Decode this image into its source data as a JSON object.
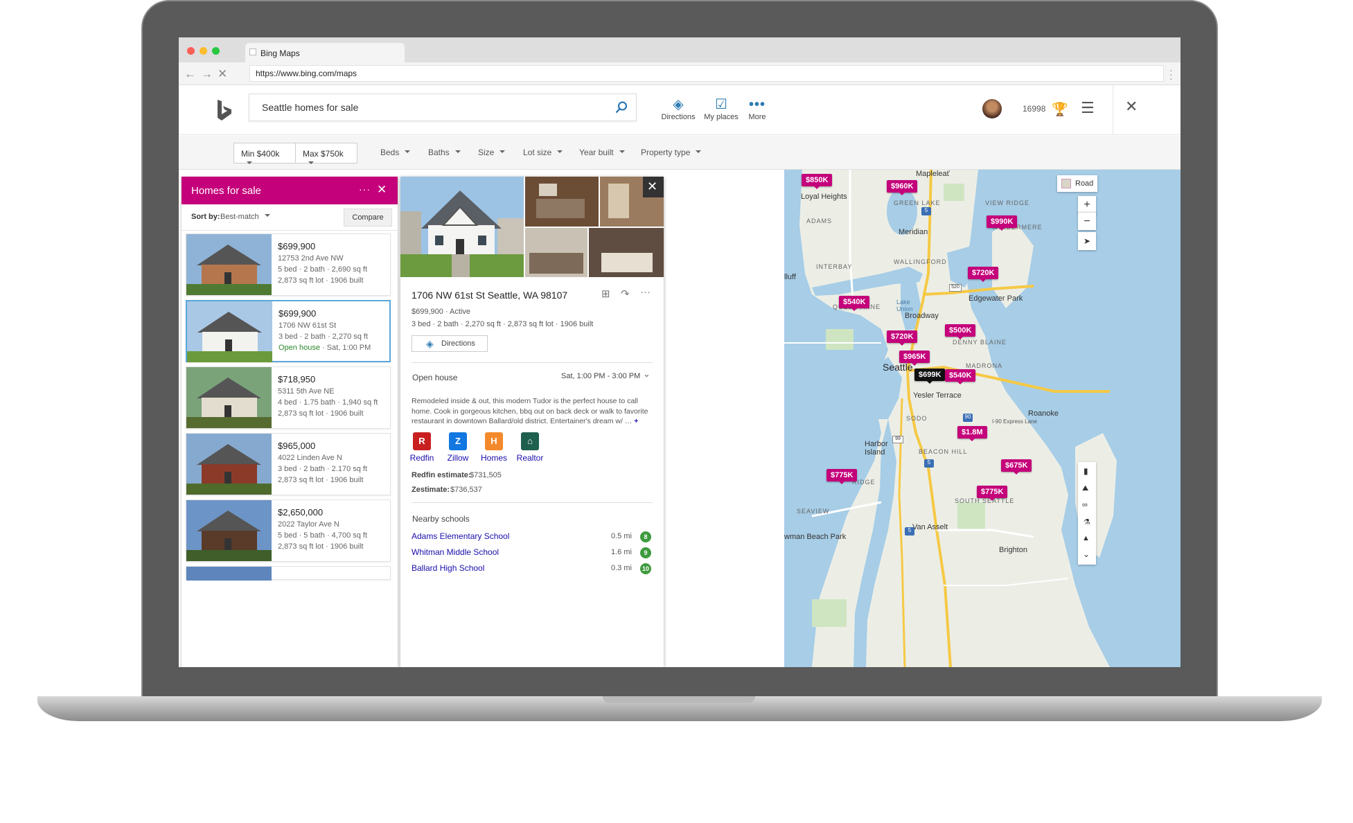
{
  "browser": {
    "tab_title": "Bing Maps",
    "url": "https://www.bing.com/maps"
  },
  "header": {
    "search_value": "Seattle homes for sale",
    "directions_label": "Directions",
    "my_places_label": "My places",
    "more_label": "More",
    "points": "16998"
  },
  "filters": {
    "min_price": "Min $400k",
    "max_price": "Max $750k",
    "beds": "Beds",
    "baths": "Baths",
    "size": "Size",
    "lot_size": "Lot size",
    "year_built": "Year built",
    "property_type": "Property type"
  },
  "results": {
    "title": "Homes for sale",
    "sort_label": "Sort by:",
    "sort_value": "Best-match",
    "compare_label": "Compare",
    "items": [
      {
        "price": "$699,900",
        "address": "12753 2nd Ave NW",
        "details": "5 bed · 2 bath · 2,690 sq ft",
        "extra": "2,873 sq ft lot · 1906 built"
      },
      {
        "price": "$699,900",
        "address": "1706 NW 61st St",
        "details": "3 bed · 2 bath · 2,270 sq ft",
        "open_house": "Open house",
        "extra": "· Sat, 1:00 PM"
      },
      {
        "price": "$718,950",
        "address": "5311 5th Ave NE",
        "details": "4 bed · 1.75 bath · 1,940 sq ft",
        "extra": "2,873 sq ft lot · 1906 built"
      },
      {
        "price": "$965,000",
        "address": "4022 Linden Ave N",
        "details": "3 bed · 2 bath · 2.170 sq ft",
        "extra": "2,873 sq ft lot · 1906 built"
      },
      {
        "price": "$2,650,000",
        "address": "2022 Taylor Ave N",
        "details": "5 bed · 5 bath · 4,700 sq ft",
        "extra": "2,873 sq ft lot · 1906 built"
      }
    ]
  },
  "detail": {
    "address": "1706 NW 61st St Seattle, WA 98107",
    "price_status": "$699,900 · Active",
    "specs": "3 bed · 2 bath · 2,270 sq ft · 2,873 sq ft lot · 1906 built",
    "directions_label": "Directions",
    "open_house_label": "Open house",
    "open_house_time": "Sat, 1:00 PM - 3:00 PM",
    "description": "Remodeled inside & out, this modern Tudor is the perfect house to call home. Cook in gorgeous kitchen, bbq out on back deck or walk to favorite restaurant in downtown Ballard/old district. Entertainer's dream w/ …",
    "more_glyph": "+",
    "sources": [
      {
        "label": "Redfin",
        "color": "#c82021",
        "glyph": "R"
      },
      {
        "label": "Zillow",
        "color": "#1277e1",
        "glyph": "Z"
      },
      {
        "label": "Homes",
        "color": "#f3892a",
        "glyph": "H"
      },
      {
        "label": "Realtor",
        "color": "#1f5f4e",
        "glyph": "⌂"
      }
    ],
    "redfin_label": "Redfin estimate:",
    "redfin_value": "$731,505",
    "zestimate_label": "Zestimate:",
    "zestimate_value": "$736,537",
    "schools_title": "Nearby schools",
    "schools": [
      {
        "name": "Adams Elementary School",
        "distance": "0.5 mi",
        "rating": "8"
      },
      {
        "name": "Whitman Middle School",
        "distance": "1.6 mi",
        "rating": "9"
      },
      {
        "name": "Ballard High School",
        "distance": "0.3 mi",
        "rating": "10"
      }
    ]
  },
  "map": {
    "style_label": "Road",
    "pins": [
      "$850K",
      "$960K",
      "$990K",
      "$720K",
      "$540K",
      "$500K",
      "$720K",
      "$965K",
      "$699K",
      "$540K",
      "$1.8M",
      "$775K",
      "$675K",
      "$775K"
    ],
    "places": [
      "Mapleleať",
      "Loyal Heights",
      "Meridian",
      "Edgewater Park",
      "Broadway",
      "Seattle",
      "Yesler Terrace",
      "Roanoke",
      "Harbor Island",
      "Van Asselt",
      "Brighton",
      "wman Beach Park",
      "lluff"
    ],
    "neighborhoods": [
      "GREEN LAKE",
      "VIEW RIDGE",
      "ADAMS",
      "WINDERMERE",
      "WALLINGFORD",
      "INTERBAY",
      "QUEEN ANNE",
      "DENNY BLAINE",
      "MADRONA",
      "SODO",
      "BEACON HILL",
      "RIDGE",
      "SOUTH SEATTLE",
      "SEAVIEW"
    ],
    "lake_label": "Lake Union",
    "express_lane": "I-90 Express Lane",
    "shields": [
      "5",
      "520",
      "5",
      "90",
      "99",
      "5"
    ]
  },
  "colors": {
    "accent": "#c4007a",
    "link": "#1a0dab",
    "bing_blue": "#2e7bb3"
  }
}
